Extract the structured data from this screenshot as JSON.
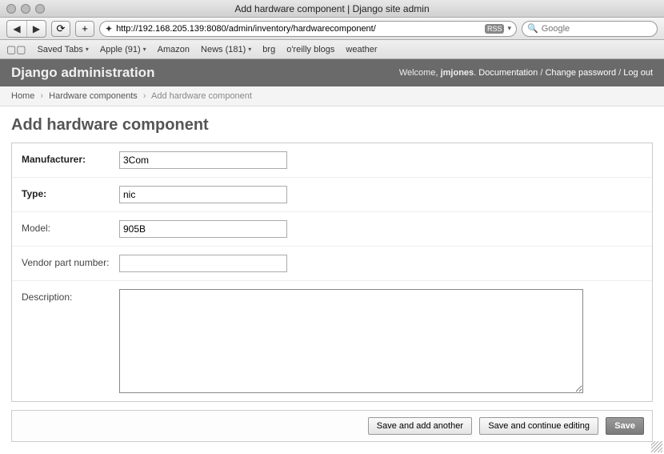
{
  "window": {
    "title": "Add hardware component | Django site admin"
  },
  "browser": {
    "url": "http://192.168.205.139:8080/admin/inventory/hardwarecomponent/",
    "rss_label": "RSS",
    "search_placeholder": "Google"
  },
  "bookmarks": {
    "saved_tabs": "Saved Tabs",
    "apple": "Apple (91)",
    "amazon": "Amazon",
    "news": "News (181)",
    "brg": "brg",
    "oreilly": "o'reilly blogs",
    "weather": "weather"
  },
  "header": {
    "site_title": "Django administration",
    "welcome": "Welcome, ",
    "username": "jmjones",
    "period": ". ",
    "doc": "Documentation",
    "change_pw": "Change password",
    "logout": "Log out",
    "sep": " / "
  },
  "breadcrumbs": {
    "home": "Home",
    "hw": "Hardware components",
    "current": "Add hardware component"
  },
  "page": {
    "heading": "Add hardware component"
  },
  "form": {
    "manufacturer": {
      "label": "Manufacturer:",
      "value": "3Com"
    },
    "type": {
      "label": "Type:",
      "value": "nic"
    },
    "model": {
      "label": "Model:",
      "value": "905B"
    },
    "vendor_part": {
      "label": "Vendor part number:",
      "value": ""
    },
    "description": {
      "label": "Description:",
      "value": ""
    }
  },
  "buttons": {
    "save_add": "Save and add another",
    "save_continue": "Save and continue editing",
    "save": "Save"
  }
}
